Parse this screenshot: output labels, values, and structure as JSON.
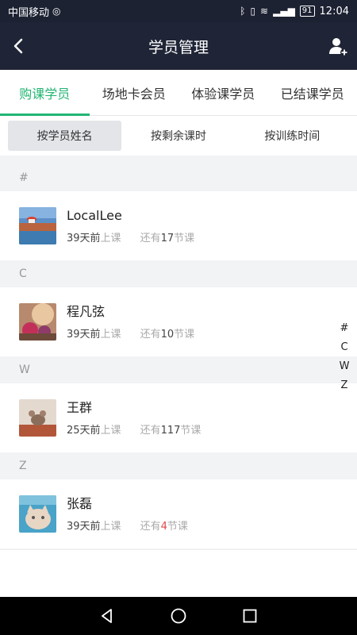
{
  "status_bar": {
    "carrier": "中国移动",
    "battery": "91",
    "time": "12:04"
  },
  "header": {
    "title": "学员管理"
  },
  "tabs": [
    {
      "label": "购课学员",
      "active": true
    },
    {
      "label": "场地卡会员",
      "active": false
    },
    {
      "label": "体验课学员",
      "active": false
    },
    {
      "label": "已结课学员",
      "active": false
    }
  ],
  "sort_options": [
    {
      "label": "按学员姓名",
      "active": true
    },
    {
      "label": "按剩余课时",
      "active": false
    },
    {
      "label": "按训练时间",
      "active": false
    }
  ],
  "sections": [
    {
      "letter": "#",
      "students": [
        {
          "name": "LocalLee",
          "ago": "39天前",
          "ago_suffix": "上课",
          "remain_prefix": "还有",
          "remain_count": "17",
          "remain_suffix": "节课"
        }
      ]
    },
    {
      "letter": "C",
      "students": [
        {
          "name": "程凡弦",
          "ago": "39天前",
          "ago_suffix": "上课",
          "remain_prefix": "还有",
          "remain_count": "10",
          "remain_suffix": "节课"
        }
      ]
    },
    {
      "letter": "W",
      "students": [
        {
          "name": "王群",
          "ago": "25天前",
          "ago_suffix": "上课",
          "remain_prefix": "还有",
          "remain_count": "117",
          "remain_suffix": "节课"
        }
      ]
    },
    {
      "letter": "Z",
      "students": [
        {
          "name": "张磊",
          "ago": "39天前",
          "ago_suffix": "上课",
          "remain_prefix": "还有",
          "remain_count": "4",
          "remain_suffix": "节课",
          "low": true
        }
      ]
    }
  ],
  "index_letters": [
    "#",
    "C",
    "W",
    "Z"
  ],
  "colors": {
    "accent": "#22b573",
    "header_bg": "#1f2536",
    "warning": "#e04848"
  }
}
